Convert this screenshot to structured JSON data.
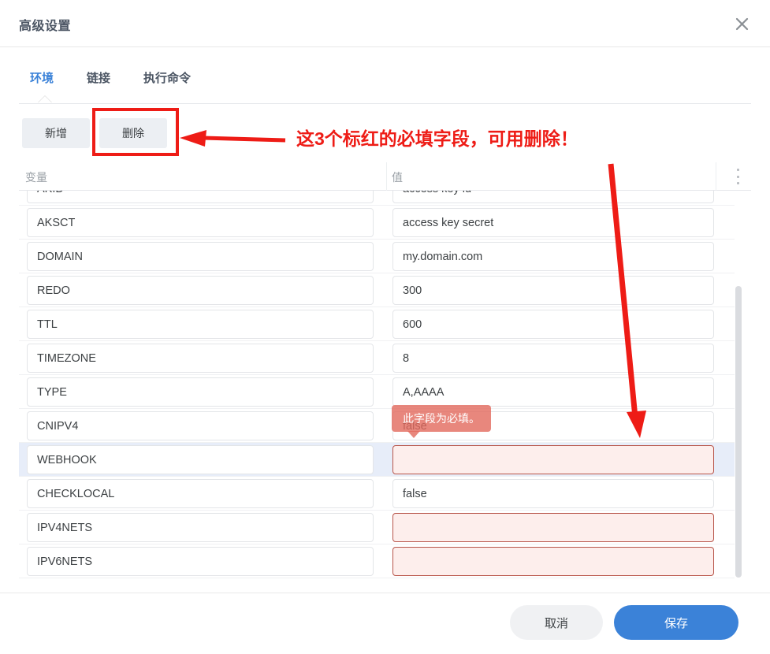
{
  "dialog": {
    "title": "高级设置",
    "close_icon": "close-icon"
  },
  "tabs": [
    {
      "label": "环境",
      "active": true
    },
    {
      "label": "链接",
      "active": false
    },
    {
      "label": "执行命令",
      "active": false
    }
  ],
  "toolbar": {
    "add_label": "新增",
    "delete_label": "删除"
  },
  "table": {
    "headers": {
      "variable": "变量",
      "value": "值"
    },
    "kebab_icon": "more-vertical-icon",
    "rows": [
      {
        "variable": "AKID",
        "value": "access key id",
        "error": false,
        "selected": false,
        "clipped": true
      },
      {
        "variable": "AKSCT",
        "value": "access key secret",
        "error": false,
        "selected": false
      },
      {
        "variable": "DOMAIN",
        "value": "my.domain.com",
        "error": false,
        "selected": false
      },
      {
        "variable": "REDO",
        "value": "300",
        "error": false,
        "selected": false
      },
      {
        "variable": "TTL",
        "value": "600",
        "error": false,
        "selected": false
      },
      {
        "variable": "TIMEZONE",
        "value": "8",
        "error": false,
        "selected": false
      },
      {
        "variable": "TYPE",
        "value": "A,AAAA",
        "error": false,
        "selected": false
      },
      {
        "variable": "CNIPV4",
        "value": "false",
        "error": false,
        "selected": false
      },
      {
        "variable": "WEBHOOK",
        "value": "",
        "error": true,
        "selected": true
      },
      {
        "variable": "CHECKLOCAL",
        "value": "false",
        "error": false,
        "selected": false
      },
      {
        "variable": "IPV4NETS",
        "value": "",
        "error": true,
        "selected": false
      },
      {
        "variable": "IPV6NETS",
        "value": "",
        "error": true,
        "selected": false
      }
    ]
  },
  "tooltip": {
    "text": "此字段为必填。"
  },
  "footer": {
    "cancel_label": "取消",
    "save_label": "保存"
  },
  "annotation": {
    "text": "这3个标红的必填字段，可用删除！",
    "color": "#ee1c16"
  },
  "colors": {
    "accent": "#3b82d8",
    "annotation_red": "#ee1c16",
    "error_bg": "#fdeeec",
    "error_border": "#b8554a",
    "selected_row": "#e7edf9",
    "tooltip_bg": "#e2695c"
  }
}
